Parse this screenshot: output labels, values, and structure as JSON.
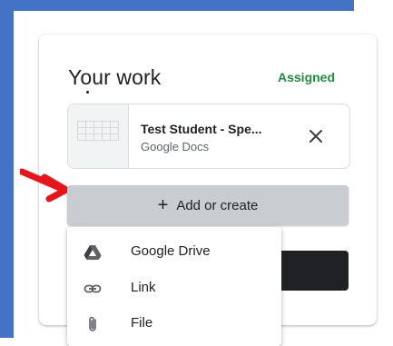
{
  "work": {
    "title": "Your work",
    "status": "Assigned",
    "status_color": "#1e8e3e"
  },
  "attachment": {
    "title": "Test Student - Spe...",
    "type": "Google Docs",
    "remove_icon": "close-icon"
  },
  "add_button": {
    "icon": "plus-icon",
    "label": "Add or create"
  },
  "menu": {
    "items": [
      {
        "icon": "google-drive-icon",
        "label": "Google Drive"
      },
      {
        "icon": "link-icon",
        "label": "Link"
      },
      {
        "icon": "paperclip-icon",
        "label": "File"
      }
    ]
  },
  "colors": {
    "frame_blue": "#4472c4",
    "annotation_arrow": "#e8141a"
  }
}
